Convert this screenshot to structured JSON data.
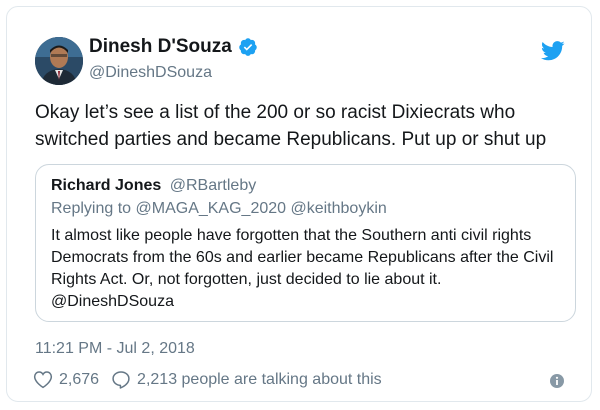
{
  "author": {
    "display_name": "Dinesh D'Souza",
    "handle": "@DineshDSouza",
    "verified": true
  },
  "tweet": {
    "text": "Okay let’s see a list of the 200 or so racist Dixiecrats who switched parties and became Republicans. Put up or shut up"
  },
  "quoted": {
    "name": "Richard Jones",
    "handle": "@RBartleby",
    "replying_to_label": "Replying to",
    "replying_to_handles": "@MAGA_KAG_2020 @keithboykin",
    "text": "It almost like people have forgotten that the Southern anti civil rights Democrats from the 60s and earlier became Republicans after the Civil Rights Act. Or, not forgotten, just decided to lie about it. @DineshDSouza"
  },
  "meta": {
    "timestamp": "11:21 PM - Jul 2, 2018",
    "likes": "2,676",
    "talking": "2,213 people are talking about this"
  },
  "icons": {
    "verified": "verified-badge-icon",
    "bird": "twitter-bird-icon",
    "like": "heart-icon",
    "reply": "reply-bubble-icon",
    "info": "info-icon"
  },
  "colors": {
    "accent": "#1da1f2",
    "text": "#14171a",
    "muted": "#657786",
    "border": "#e1e8ed",
    "link": "#1b95e0"
  }
}
